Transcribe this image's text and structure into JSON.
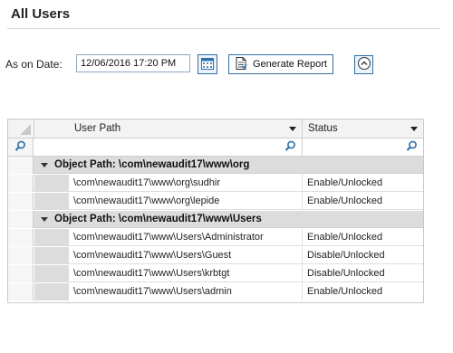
{
  "page": {
    "title": "All Users"
  },
  "toolbar": {
    "date_label": "As on Date:",
    "date_value": "12/06/2016 17:20 PM",
    "generate_label": "Generate Report"
  },
  "grid": {
    "columns": {
      "path": "User Path",
      "status": "Status"
    },
    "groups": [
      {
        "label": "Object Path: \\com\\newaudit17\\www\\org",
        "rows": [
          {
            "path": "\\com\\newaudit17\\www\\org\\sudhir",
            "status": "Enable/Unlocked"
          },
          {
            "path": "\\com\\newaudit17\\www\\org\\lepide",
            "status": "Enable/Unlocked"
          }
        ]
      },
      {
        "label": "Object Path: \\com\\newaudit17\\www\\Users",
        "rows": [
          {
            "path": "\\com\\newaudit17\\www\\Users\\Administrator",
            "status": "Enable/Unlocked"
          },
          {
            "path": "\\com\\newaudit17\\www\\Users\\Guest",
            "status": "Disable/Unlocked"
          },
          {
            "path": "\\com\\newaudit17\\www\\Users\\krbtgt",
            "status": "Disable/Unlocked"
          },
          {
            "path": "\\com\\newaudit17\\www\\Users\\admin",
            "status": "Enable/Unlocked"
          }
        ]
      }
    ]
  },
  "icons": {
    "calendar": "calendar-icon",
    "report": "report-icon",
    "collapse": "chevron-up-icon",
    "filter": "search-icon"
  },
  "colors": {
    "accent": "#2f6fa8",
    "group_band": "#dcdcdc"
  }
}
